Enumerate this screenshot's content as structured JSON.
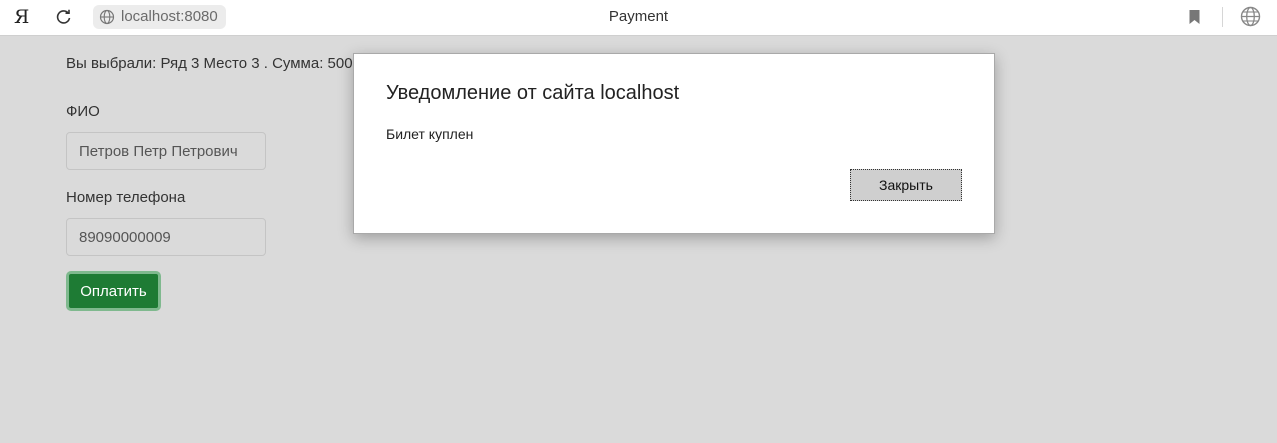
{
  "browser": {
    "logo": "Я",
    "url": "localhost:8080",
    "tab_title": "Payment"
  },
  "page": {
    "selection_text": "Вы выбрали: Ряд 3 Место 3 . Сумма: 500",
    "fio_label": "ФИО",
    "fio_value": "Петров Петр Петрович",
    "phone_label": "Номер телефона",
    "phone_value": "89090000009",
    "pay_button_label": "Оплатить"
  },
  "dialog": {
    "title": "Уведомление от сайта localhost",
    "message": "Билет куплен",
    "close_label": "Закрыть"
  },
  "colors": {
    "pay_button": "#1e7b34",
    "backdrop": "#dadada"
  }
}
